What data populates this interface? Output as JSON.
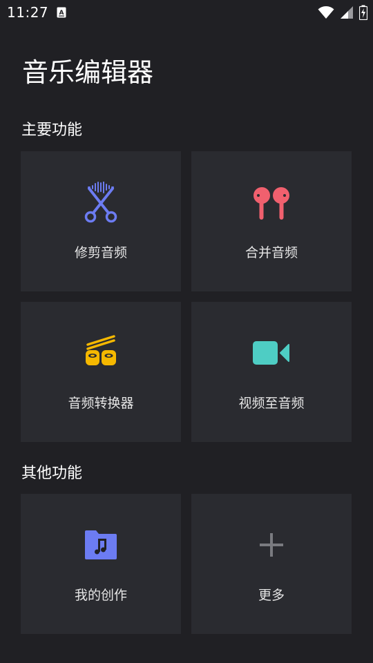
{
  "status_bar": {
    "time": "11:27",
    "icons": [
      "notification-a-icon",
      "wifi-icon",
      "signal-icon",
      "battery-charging-icon"
    ]
  },
  "app": {
    "title": "音乐编辑器"
  },
  "sections": [
    {
      "title": "主要功能",
      "cards": [
        {
          "label": "修剪音频",
          "icon": "scissors-waveform-icon",
          "color": "#6c7cf2"
        },
        {
          "label": "合并音频",
          "icon": "earbuds-icon",
          "color": "#f0606e"
        },
        {
          "label": "音频转换器",
          "icon": "converter-sushi-icon",
          "color": "#f5b800"
        },
        {
          "label": "视频至音频",
          "icon": "video-camera-icon",
          "color": "#4ecdc4"
        }
      ]
    },
    {
      "title": "其他功能",
      "cards": [
        {
          "label": "我的创作",
          "icon": "music-folder-icon",
          "color": "#6c7cf2"
        },
        {
          "label": "更多",
          "icon": "plus-icon",
          "color": "#7a7b80"
        }
      ]
    }
  ],
  "colors": {
    "background": "#202024",
    "card": "#2a2b30",
    "text": "#ffffff"
  }
}
